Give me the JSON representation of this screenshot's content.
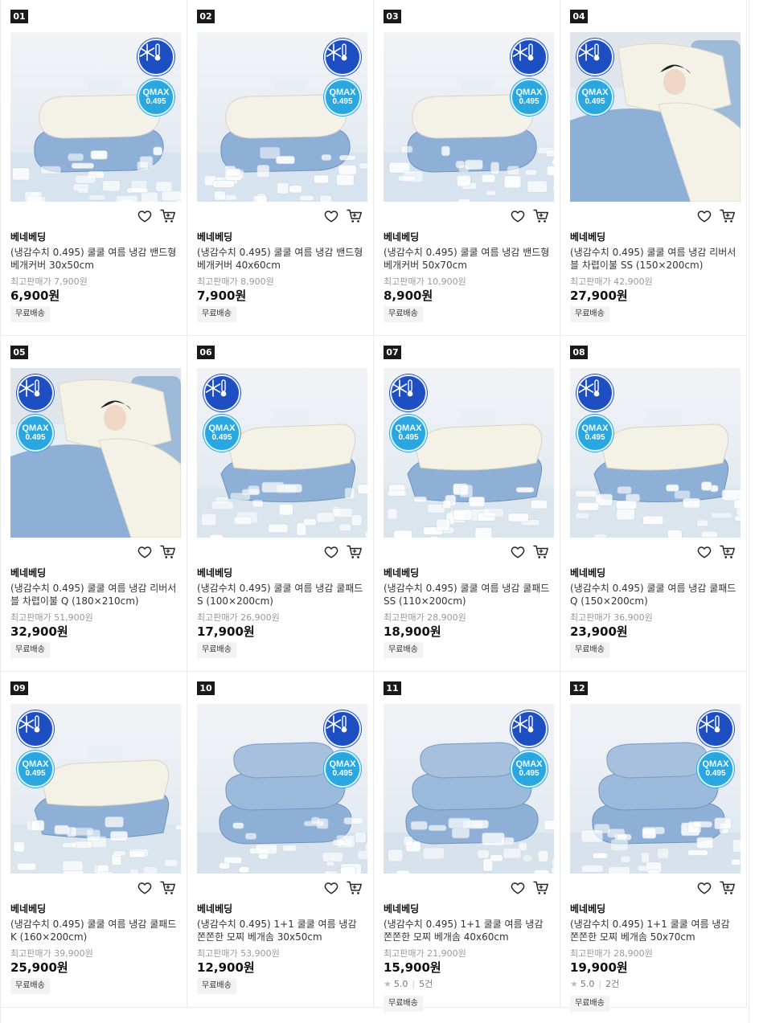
{
  "products": [
    {
      "rank": "01",
      "brand": "베네베딩",
      "title": "(냉감수치 0.495) 쿨쿨 여름 냉감 밴드형 베개커버 30x50cm",
      "original_price": "최고판매가 7,900원",
      "price": "6,900원",
      "tag": "무료배송",
      "image": "pillow-covers",
      "badge_side": "right"
    },
    {
      "rank": "02",
      "brand": "베네베딩",
      "title": "(냉감수치 0.495) 쿨쿨 여름 냉감 밴드형 베개커버 40x60cm",
      "original_price": "최고판매가 8,900원",
      "price": "7,900원",
      "tag": "무료배송",
      "image": "pillow-covers",
      "badge_side": "right"
    },
    {
      "rank": "03",
      "brand": "베네베딩",
      "title": "(냉감수치 0.495) 쿨쿨 여름 냉감 밴드형 베개커버 50x70cm",
      "original_price": "최고판매가 10,900원",
      "price": "8,900원",
      "tag": "무료배송",
      "image": "pillow-covers",
      "badge_side": "right"
    },
    {
      "rank": "04",
      "brand": "베네베딩",
      "title": "(냉감수치 0.495) 쿨쿨 여름 냉감 리버서블 차렵이불 SS (150×200cm)",
      "original_price": "최고판매가 42,900원",
      "price": "27,900원",
      "tag": "무료배송",
      "image": "woman-sleeping",
      "badge_side": "left"
    },
    {
      "rank": "05",
      "brand": "베네베딩",
      "title": "(냉감수치 0.495) 쿨쿨 여름 냉감 리버서블 차렵이불 Q (180×210cm)",
      "original_price": "최고판매가 51,900원",
      "price": "32,900원",
      "tag": "무료배송",
      "image": "woman-sleeping",
      "badge_side": "left"
    },
    {
      "rank": "06",
      "brand": "베네베딩",
      "title": "(냉감수치 0.495) 쿨쿨 여름 냉감 쿨패드 S (100×200cm)",
      "original_price": "최고판매가 26,900원",
      "price": "17,900원",
      "tag": "무료배송",
      "image": "folded-pads",
      "badge_side": "left"
    },
    {
      "rank": "07",
      "brand": "베네베딩",
      "title": "(냉감수치 0.495) 쿨쿨 여름 냉감 쿨패드 SS (110×200cm)",
      "original_price": "최고판매가 28,900원",
      "price": "18,900원",
      "tag": "무료배송",
      "image": "folded-pads",
      "badge_side": "left"
    },
    {
      "rank": "08",
      "brand": "베네베딩",
      "title": "(냉감수치 0.495) 쿨쿨 여름 냉감 쿨패드 Q (150×200cm)",
      "original_price": "최고판매가 36,900원",
      "price": "23,900원",
      "tag": "무료배송",
      "image": "folded-pads",
      "badge_side": "left"
    },
    {
      "rank": "09",
      "brand": "베네베딩",
      "title": "(냉감수치 0.495) 쿨쿨 여름 냉감 쿨패드 K (160×200cm)",
      "original_price": "최고판매가 39,900원",
      "price": "25,900원",
      "tag": "무료배송",
      "image": "folded-pads",
      "badge_side": "left"
    },
    {
      "rank": "10",
      "brand": "베네베딩",
      "title": "(냉감수치 0.495) 1+1 쿨쿨 여름 냉감 쫀쫀한 모찌 베개솜 30x50cm",
      "original_price": "최고판매가 53,900원",
      "price": "12,900원",
      "tag": "무료배송",
      "image": "pillows",
      "badge_side": "right"
    },
    {
      "rank": "11",
      "brand": "베네베딩",
      "title": "(냉감수치 0.495) 1+1 쿨쿨 여름 냉감 쫀쫀한 모찌 베개솜 40x60cm",
      "original_price": "최고판매가 21,900원",
      "price": "15,900원",
      "rating": "5.0",
      "reviews": "5건",
      "tag": "무료배송",
      "image": "pillows",
      "badge_side": "right"
    },
    {
      "rank": "12",
      "brand": "베네베딩",
      "title": "(냉감수치 0.495) 1+1 쿨쿨 여름 냉감 쫀쫀한 모찌 베개솜 50x70cm",
      "original_price": "최고판매가 28,900원",
      "price": "19,900원",
      "rating": "5.0",
      "reviews": "2건",
      "tag": "무료배송",
      "image": "pillows",
      "badge_side": "right"
    }
  ],
  "badge": {
    "qmax_line1": "QMAX",
    "qmax_line2": "0.495"
  },
  "colors": {
    "accent_blue": "#1e4fc2",
    "qmax_cyan": "#2aa7e0",
    "product_blue": "#8fb0d6"
  }
}
